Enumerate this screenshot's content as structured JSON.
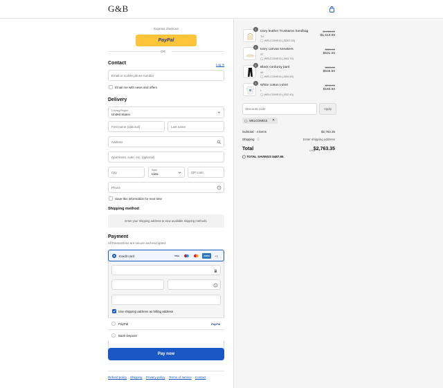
{
  "brand": {
    "logo": "G&B"
  },
  "express": {
    "title": "Express checkout",
    "paypal_label": "PayPal",
    "or": "OR"
  },
  "contact": {
    "title": "Contact",
    "login": "Log in",
    "email_placeholder": "Email or mobile phone number",
    "newsletter_label": "Email me with news and offers"
  },
  "delivery": {
    "title": "Delivery",
    "country_label": "Country/Region",
    "country_value": "United States",
    "first_name": "First name (optional)",
    "last_name": "Last name",
    "address": "Address",
    "apartment": "Apartment, suite, etc. (optional)",
    "city": "City",
    "state_label": "State",
    "state_value": "Iowa",
    "zip": "ZIP code",
    "phone": "Phone",
    "save_info": "Save this information for next time"
  },
  "shipping": {
    "title": "Shipping method",
    "note": "Enter your shipping address to view available shipping methods."
  },
  "payment": {
    "title": "Payment",
    "subtitle": "All transactions are secure and encrypted.",
    "credit_card": "Credit card",
    "card_more": "+1",
    "billing_same": "Use shipping address as billing address",
    "paypal": "PayPal",
    "bank": "Bank Deposit",
    "card_brands": [
      "VISA",
      "MC",
      "MC",
      "AMEX"
    ]
  },
  "pay_button": "Pay now",
  "footer": [
    "Refund policy",
    "Shipping",
    "Privacy policy",
    "Terms of service",
    "Contact"
  ],
  "cart": {
    "items": [
      {
        "qty": "1",
        "name": "Ivory leather Trunkaroo handbag",
        "variant": "TU",
        "discount": "WELCOME15 (-$267.00)",
        "old_price": "$1,780.00",
        "price": "$1,513.00"
      },
      {
        "qty": "1",
        "name": "Ivory canvas sneakers",
        "variant": "37",
        "discount": "WELCOME15 (-$93.75)",
        "old_price": "$625.00",
        "price": "$531.25"
      },
      {
        "qty": "1",
        "name": "Black corduroy pant",
        "variant": "46",
        "discount": "WELCOME15 (-$94.50)",
        "old_price": "$630.00",
        "price": "$535.50"
      },
      {
        "qty": "1",
        "name": "White cotton t-shirt",
        "variant": "L",
        "discount": "WELCOME15 (-$32.40)",
        "old_price": "$216.00",
        "price": "$183.60"
      }
    ],
    "discount_placeholder": "Discount code",
    "apply": "Apply",
    "applied_code": "WELCOME15",
    "subtotal_label": "Subtotal · 4 items",
    "subtotal_value": "$2,763.35",
    "shipping_label": "Shipping",
    "shipping_value": "Enter shipping address",
    "total_label": "Total",
    "currency": "USD",
    "total_value": "$2,763.35",
    "savings_label": "TOTAL SAVINGS",
    "savings_value": "$487.65"
  },
  "colors": {
    "accent": "#1a56c4",
    "paypal_yellow": "#ffc439",
    "pay_button": "#1a56c4"
  }
}
